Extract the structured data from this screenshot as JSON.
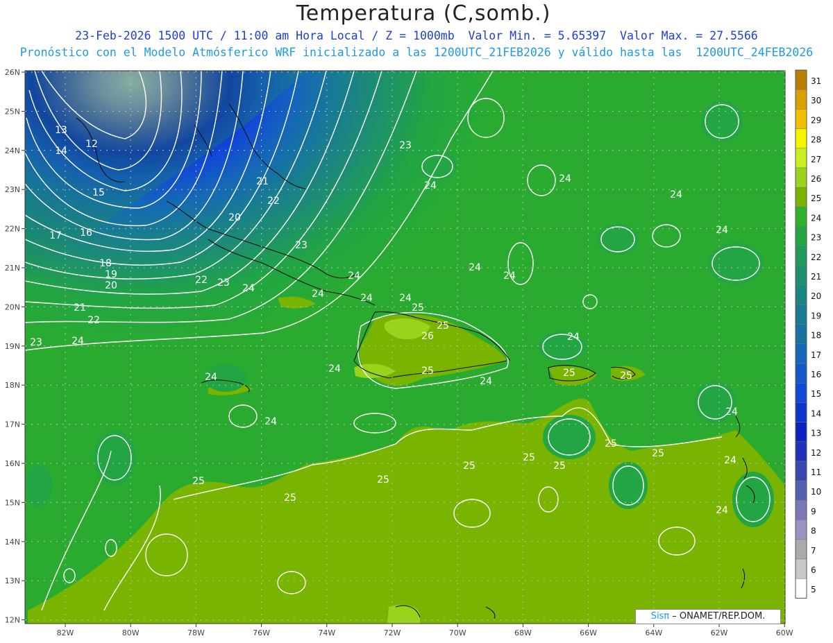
{
  "header": {
    "title": "Temperatura (C,somb.)",
    "line1": "23-Feb-2026 1500 UTC / 11:00 am Hora Local / Z = 1000mb  Valor Min. = 5.65397  Valor Max. = 27.5566",
    "line2": "Pronóstico con el Modelo Atmósferico WRF inicializado a las 1200UTC_21FEB2026 y válido hasta las  1200UTC_24FEB2026"
  },
  "map": {
    "lat_labels": [
      "26N",
      "25N",
      "24N",
      "23N",
      "22N",
      "21N",
      "20N",
      "19N",
      "18N",
      "17N",
      "16N",
      "15N",
      "14N",
      "13N",
      "12N"
    ],
    "lon_labels": [
      "82W",
      "80W",
      "78W",
      "76W",
      "74W",
      "72W",
      "70W",
      "68W",
      "66W",
      "64W",
      "62W",
      "60W"
    ],
    "contour_labels": [
      {
        "t": "13"
      },
      {
        "t": "12"
      },
      {
        "t": "14"
      },
      {
        "t": "15"
      },
      {
        "t": "17"
      },
      {
        "t": "16"
      },
      {
        "t": "18"
      },
      {
        "t": "19"
      },
      {
        "t": "20"
      },
      {
        "t": "21"
      },
      {
        "t": "22"
      },
      {
        "t": "23"
      },
      {
        "t": "21"
      },
      {
        "t": "22"
      },
      {
        "t": "20"
      },
      {
        "t": "23"
      },
      {
        "t": "22"
      },
      {
        "t": "23"
      },
      {
        "t": "23"
      },
      {
        "t": "24"
      },
      {
        "t": "24"
      },
      {
        "t": "24"
      },
      {
        "t": "24"
      },
      {
        "t": "24"
      },
      {
        "t": "24"
      },
      {
        "t": "24"
      },
      {
        "t": "24"
      },
      {
        "t": "24"
      },
      {
        "t": "24"
      },
      {
        "t": "25"
      },
      {
        "t": "26"
      },
      {
        "t": "24"
      },
      {
        "t": "25"
      },
      {
        "t": "24"
      },
      {
        "t": "24"
      },
      {
        "t": "24"
      },
      {
        "t": "24"
      },
      {
        "t": "25"
      },
      {
        "t": "25"
      },
      {
        "t": "24"
      },
      {
        "t": "24"
      },
      {
        "t": "25"
      },
      {
        "t": "25"
      },
      {
        "t": "25"
      },
      {
        "t": "25"
      },
      {
        "t": "25"
      },
      {
        "t": "25"
      },
      {
        "t": "25"
      },
      {
        "t": "25"
      },
      {
        "t": "25"
      },
      {
        "t": "24"
      },
      {
        "t": "24"
      },
      {
        "t": "24"
      }
    ],
    "colorbar": {
      "levels": [
        "31",
        "30",
        "29",
        "28",
        "27",
        "26",
        "25",
        "24",
        "23",
        "22",
        "21",
        "20",
        "19",
        "18",
        "17",
        "16",
        "15",
        "14",
        "13",
        "12",
        "11",
        "10",
        "9",
        "8",
        "7",
        "6",
        "5"
      ],
      "colors": [
        "#b87f00",
        "#d9a000",
        "#f2c000",
        "#f5f500",
        "#c8f020",
        "#9ad41a",
        "#79b400",
        "#2fb02f",
        "#22a542",
        "#1f9a5a",
        "#1d8f6e",
        "#1a8480",
        "#197a90",
        "#1872a2",
        "#1567b8",
        "#1357c8",
        "#1148d6",
        "#0d34cc",
        "#0a22c0",
        "#2030b8",
        "#3a46b0",
        "#5560b0",
        "#7a78b8",
        "#9a92c0",
        "#aaaaaa",
        "#c8c8c8",
        "#ffffff"
      ]
    }
  },
  "credit": {
    "sis": "Sisπ",
    "rest": " – ONAMET/REP.DOM."
  }
}
